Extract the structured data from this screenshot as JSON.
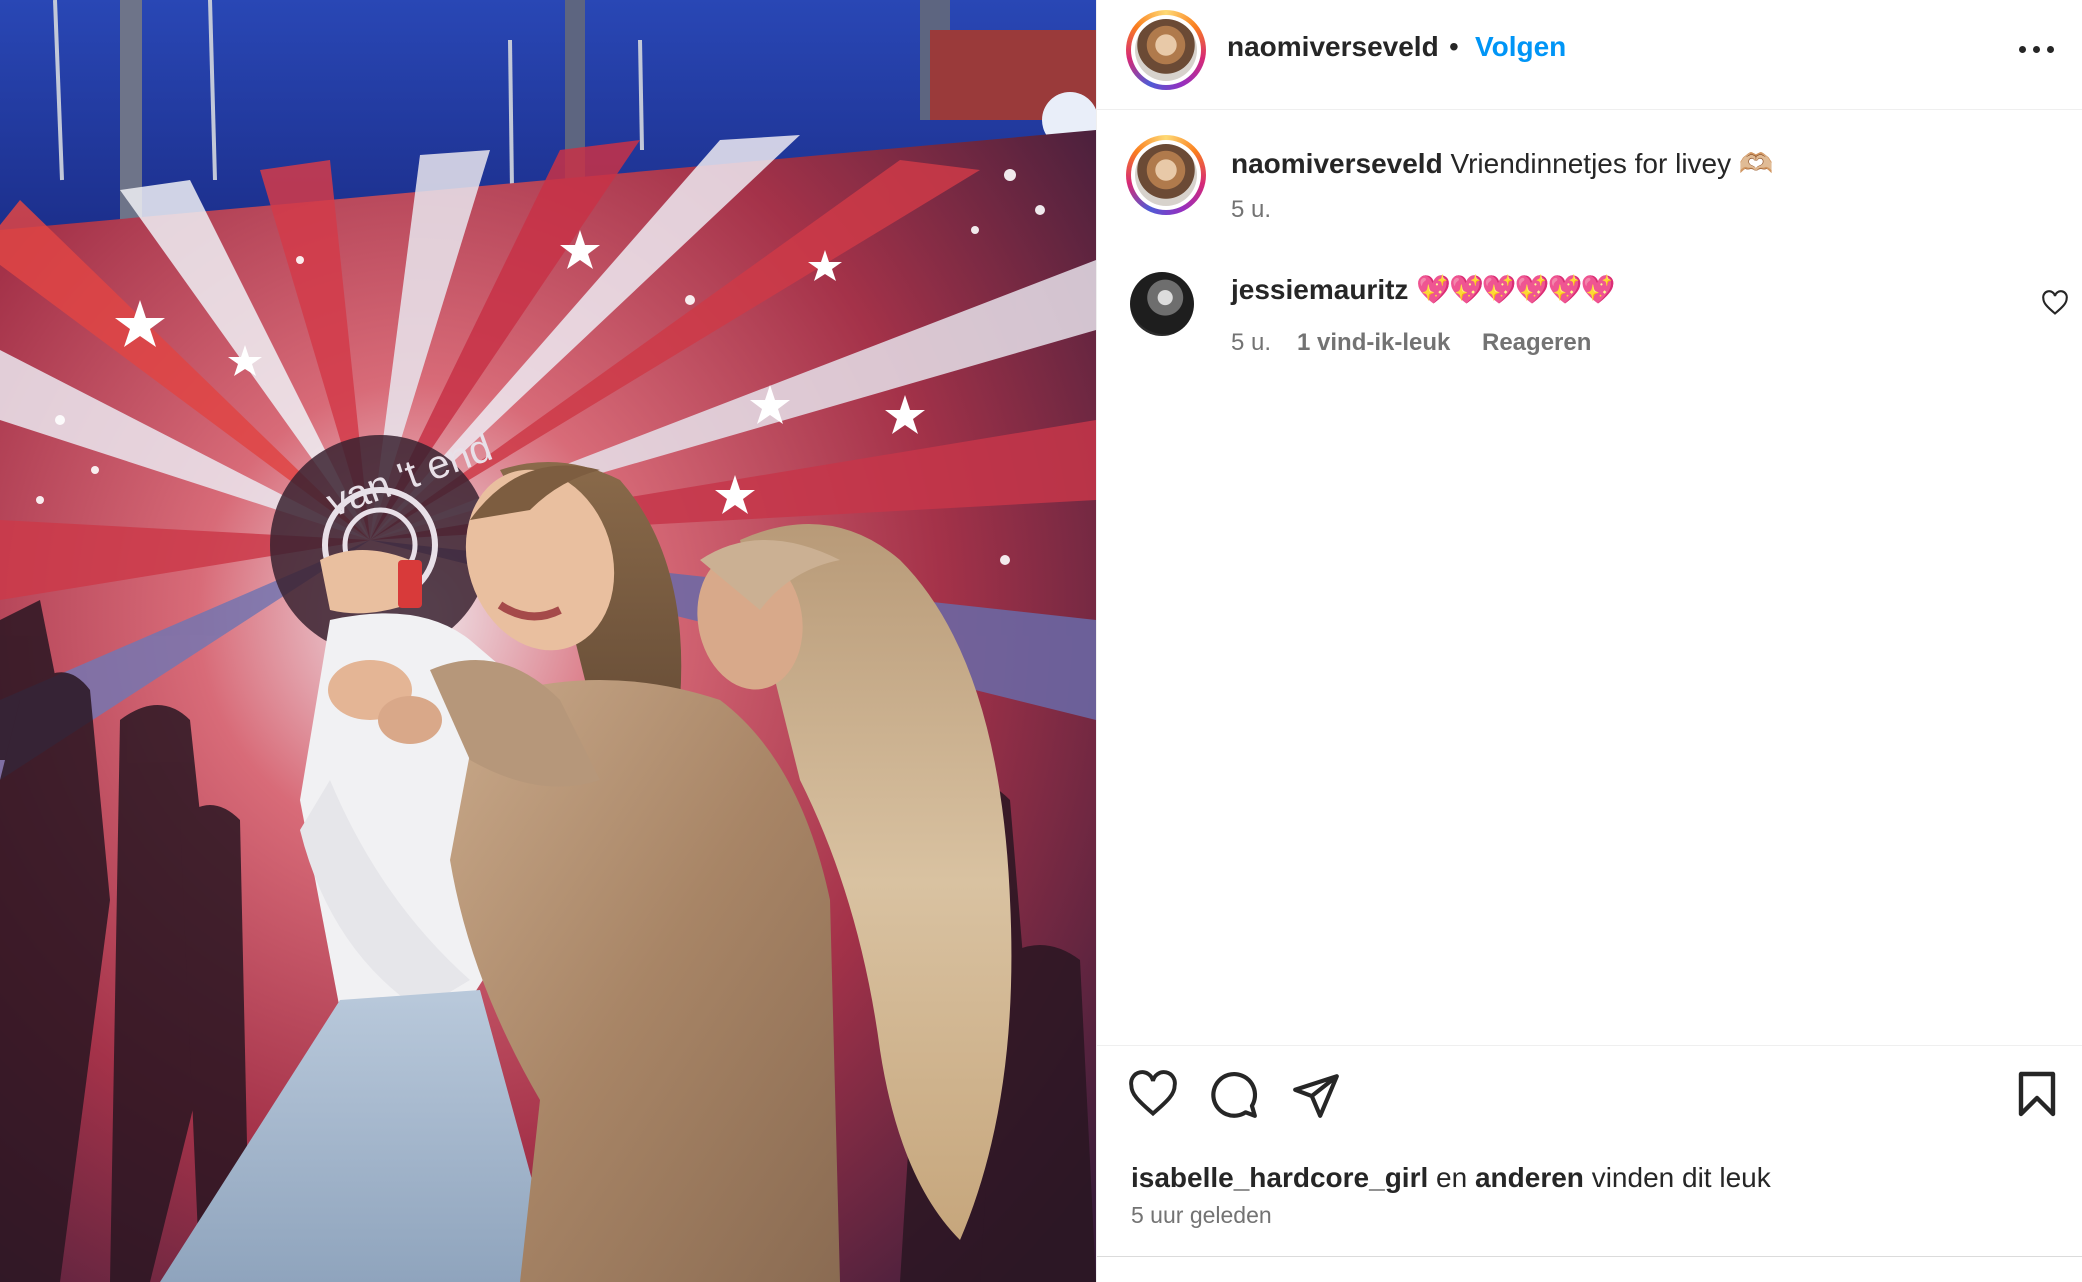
{
  "post": {
    "username": "naomiverseveld",
    "follow_label": "Volgen",
    "separator": "•"
  },
  "caption": {
    "username": "naomiverseveld",
    "text": "Vriendinnetjes for livey",
    "emoji": "🫶🏼",
    "time": "5 u."
  },
  "comment": {
    "username": "jessiemauritz",
    "text": "💖💖💖💖💖💖",
    "time": "5 u.",
    "likes": "1 vind-ik-leuk",
    "reply_label": "Reageren"
  },
  "likes": {
    "first_user": "isabelle_hardcore_girl",
    "connector": "en",
    "others": "anderen",
    "suffix": "vinden dit leuk"
  },
  "posted_ago": "5 uur geleden",
  "photo": {
    "backdrop_text": "van 't end"
  },
  "icons": {
    "more": "more-horizontal-icon",
    "like": "heart-icon",
    "comment": "comment-bubble-icon",
    "share": "paper-plane-icon",
    "save": "bookmark-icon"
  },
  "colors": {
    "follow_blue": "#0095f6",
    "text": "#262626",
    "secondary": "#737373"
  }
}
